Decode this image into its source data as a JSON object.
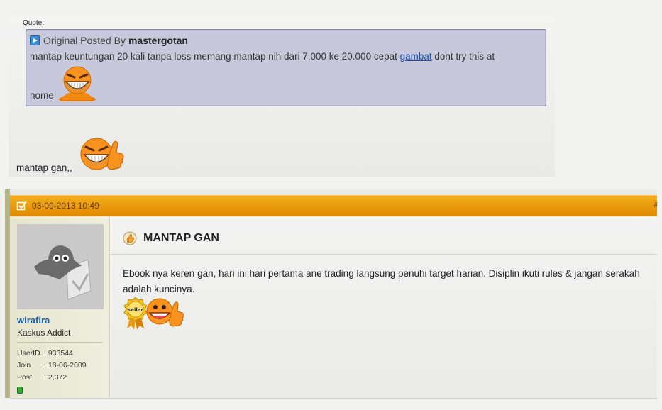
{
  "quote": {
    "label": "Quote:",
    "prefix": "Original Posted By",
    "author": "mastergotan",
    "text_before_link": "mantap keuntungan 20 kali tanpa loss memang mantap nih dari 7.000 ke 20.000 cepat ",
    "link_text": "gambat",
    "text_after_link": " dont try this at",
    "text_end": "home"
  },
  "top_post": {
    "reply_text": "mantap gan,,"
  },
  "post": {
    "date": "03-09-2013 10:49",
    "header_right": "#",
    "user": {
      "name": "wirafira",
      "title": "Kaskus Addict",
      "stats": [
        {
          "key": "UserID",
          "value": ": 933544"
        },
        {
          "key": "Join",
          "value": ": 18-06-2009"
        },
        {
          "key": "Post",
          "value": ": 2,372"
        }
      ]
    },
    "title": "MANTAP GAN",
    "body": "Ebook nya keren gan, hari ini hari pertama ane trading langsung penuhi target harian. Disiplin ikuti rules & jangan serakah adalah kuncinya.",
    "badge_text": "seller"
  },
  "colors": {
    "header_orange": "#f0a010",
    "quote_bg": "#c8c8dc",
    "username_blue": "#1d5fa8",
    "userbar_bg": "#e7e6cf",
    "smiley_orange": "#f28a10"
  },
  "icons": [
    "play-icon",
    "grin-smiley-icon",
    "thumbs-up-smiley-icon",
    "check-icon",
    "thumbs-up-icon",
    "ghost-avatar-icon",
    "seller-badge-icon",
    "online-status-icon"
  ]
}
